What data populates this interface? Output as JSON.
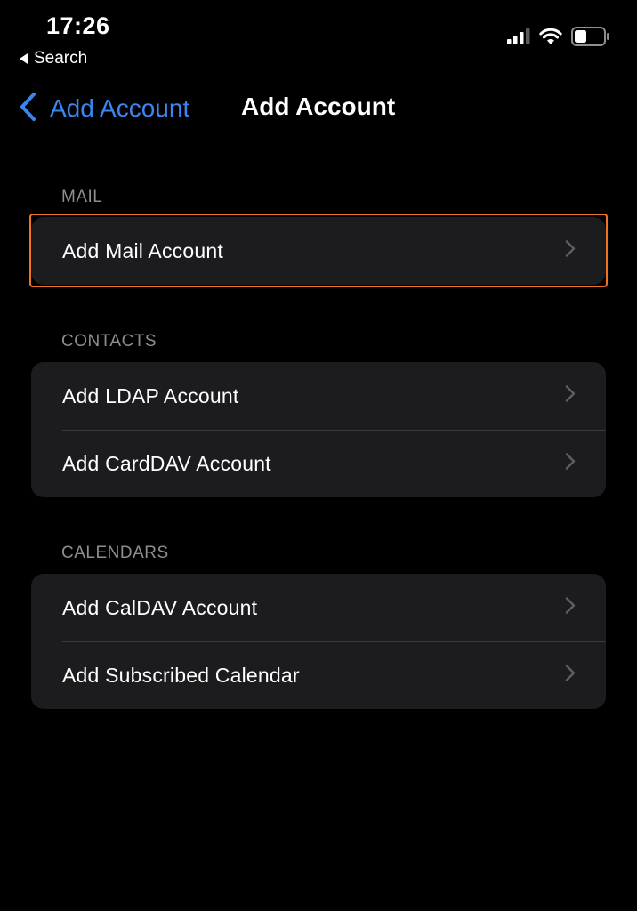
{
  "status_bar": {
    "time": "17:26",
    "back_app_label": "Search",
    "icons": [
      "cellular-signal-icon",
      "wifi-icon",
      "battery-icon"
    ]
  },
  "nav": {
    "back_label": "Add Account",
    "title": "Add Account"
  },
  "sections": [
    {
      "header": "MAIL",
      "items": [
        {
          "label": "Add Mail Account",
          "highlighted": true
        }
      ]
    },
    {
      "header": "CONTACTS",
      "items": [
        {
          "label": "Add LDAP Account"
        },
        {
          "label": "Add CardDAV Account"
        }
      ]
    },
    {
      "header": "CALENDARS",
      "items": [
        {
          "label": "Add CalDAV Account"
        },
        {
          "label": "Add Subscribed Calendar"
        }
      ]
    }
  ],
  "colors": {
    "background": "#000000",
    "group_background": "#1c1c1e",
    "accent": "#3a86f0",
    "section_header": "#8d8d92",
    "highlight_border": "#f07423"
  }
}
